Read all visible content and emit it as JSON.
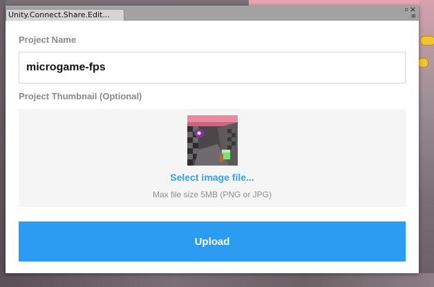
{
  "window": {
    "tab_title": "Unity.Connect.Share.Edit...",
    "close_glyph": "×",
    "maximize_glyph": "▫",
    "menu_glyph": "≡"
  },
  "form": {
    "project_name_label": "Project Name",
    "project_name_value": "microgame-fps",
    "thumbnail_label": "Project Thumbnail (Optional)",
    "select_image_label": "Select image file...",
    "max_size_note": "Max file size 5MB (PNG or JPG)",
    "upload_label": "Upload"
  },
  "icons": {
    "close": "close-icon",
    "maximize": "maximize-icon",
    "menu": "menu-icon"
  },
  "colors": {
    "accent": "#2b9cf2",
    "link": "#2fa3e6",
    "label": "#8a8a8a",
    "thumbnail_bg": "#f5f5f5"
  }
}
